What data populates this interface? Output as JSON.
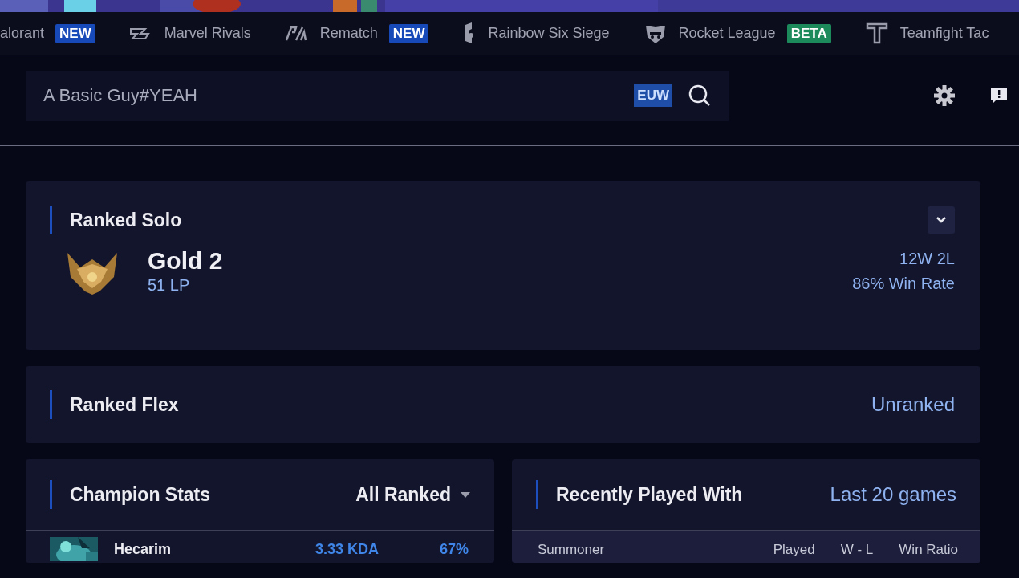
{
  "games": [
    {
      "name": "alorant",
      "badge": {
        "text": "NEW",
        "color": "#1849b8"
      }
    },
    {
      "name": "Marvel Rivals"
    },
    {
      "name": "Rematch",
      "badge": {
        "text": "NEW",
        "color": "#1849b8"
      }
    },
    {
      "name": "Rainbow Six Siege"
    },
    {
      "name": "Rocket League",
      "badge": {
        "text": "BETA",
        "color": "#1d8a5c"
      }
    },
    {
      "name": "Teamfight Tac"
    }
  ],
  "search": {
    "value": "A Basic Guy#YEAH",
    "region": "EUW"
  },
  "ranked_solo": {
    "title": "Ranked Solo",
    "tier": "Gold 2",
    "lp": "51 LP",
    "record": "12W 2L",
    "win_rate": "86% Win Rate"
  },
  "ranked_flex": {
    "title": "Ranked Flex",
    "status": "Unranked"
  },
  "champion_stats": {
    "title": "Champion Stats",
    "filter": "All Ranked",
    "rows": [
      {
        "name": "Hecarim",
        "kda": "3.33 KDA",
        "win_rate": "67%"
      }
    ]
  },
  "recently_played": {
    "title": "Recently Played With",
    "range": "Last 20 games",
    "columns": [
      "Summoner",
      "Played",
      "W - L",
      "Win Ratio"
    ]
  }
}
